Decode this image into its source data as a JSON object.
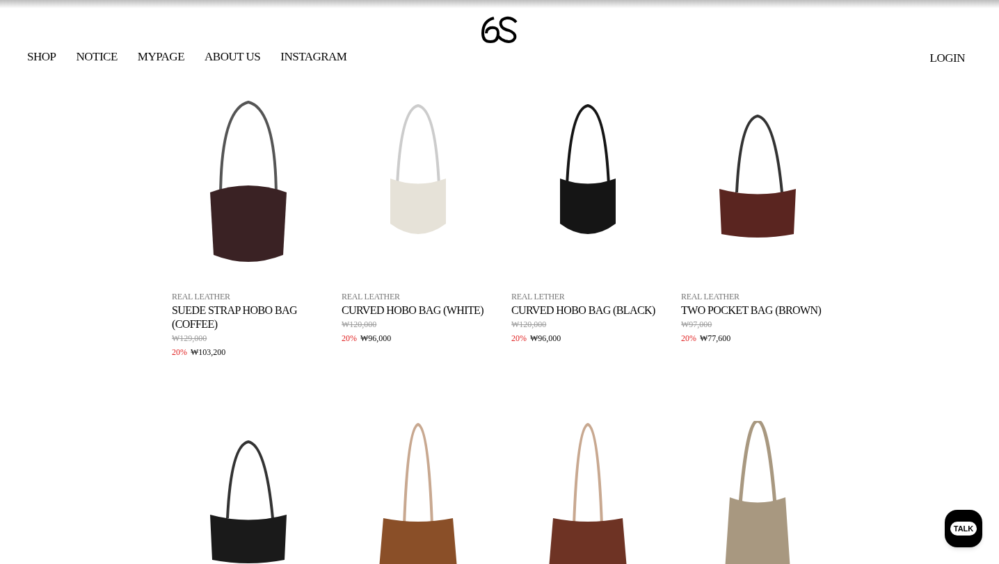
{
  "nav": {
    "items": [
      "SHOP",
      "NOTICE",
      "MYPAGE",
      "ABOUT US",
      "INSTAGRAM"
    ],
    "login": "LOGIN"
  },
  "products": [
    {
      "category": "REAL LEATHER",
      "name": "SUEDE STRAP HOBO BAG (COFFEE)",
      "original_price": "₩129,000",
      "discount": "20%",
      "price": "₩103,200",
      "color": "#3a2224",
      "kind": "hobo"
    },
    {
      "category": "REAL LEATHER",
      "name": "CURVED HOBO BAG (WHITE)",
      "original_price": "₩120,000",
      "discount": "20%",
      "price": "₩96,000",
      "color": "#e6e2d8",
      "kind": "curved"
    },
    {
      "category": "REAL LETHER",
      "name": "CURVED HOBO BAG (BLACK)",
      "original_price": "₩120,000",
      "discount": "20%",
      "price": "₩96,000",
      "color": "#151515",
      "kind": "curved"
    },
    {
      "category": "REAL LEATHER",
      "name": "TWO POCKET BAG (BROWN)",
      "original_price": "₩97,000",
      "discount": "20%",
      "price": "₩77,600",
      "color": "#5a2520",
      "kind": "pocket"
    }
  ],
  "more_products": [
    {
      "color": "#1a1a1a",
      "kind": "pocket"
    },
    {
      "color": "#8a4f28",
      "kind": "suede"
    },
    {
      "color": "#6e3324",
      "kind": "suede"
    },
    {
      "color": "#a89880",
      "kind": "tall"
    }
  ],
  "chat": {
    "label": "TALK"
  }
}
